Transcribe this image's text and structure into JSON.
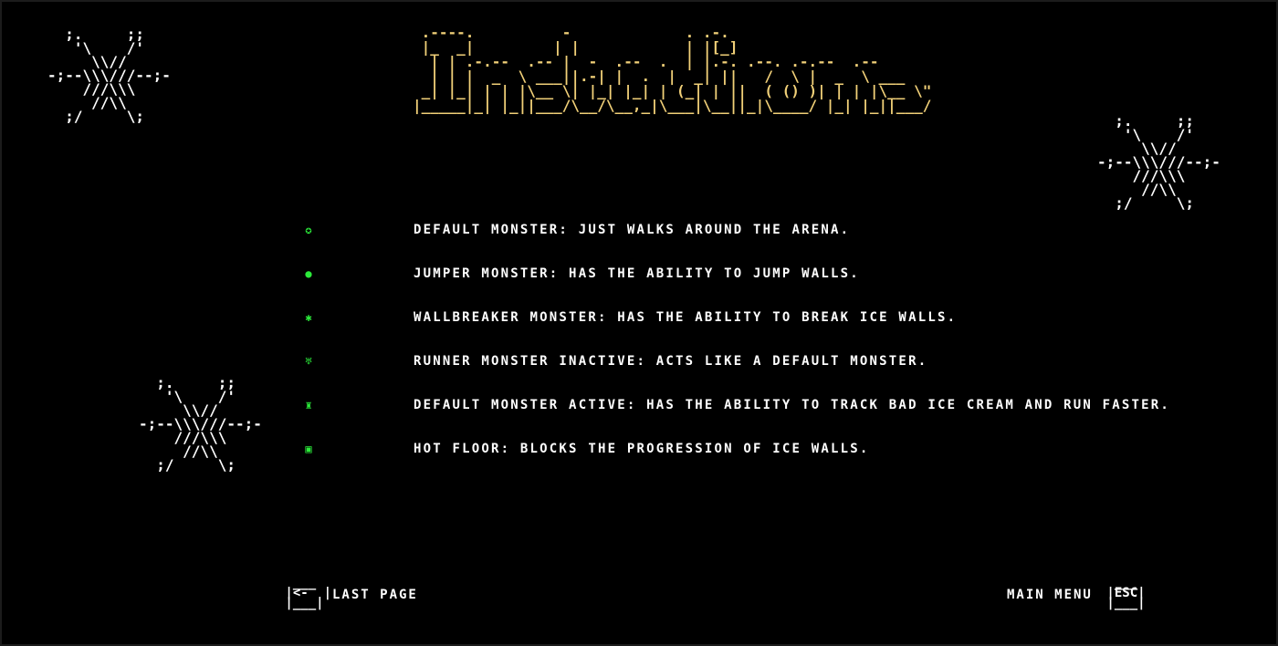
{
  "title": "Instructions",
  "title_color": "#f1d078",
  "legend": [
    {
      "icon": "green-star-icon",
      "glyph": "✪",
      "text": "Default monster: just walks around the arena."
    },
    {
      "icon": "green-blob-icon",
      "glyph": "●",
      "text": "Jumper monster: has the ability to jump walls."
    },
    {
      "icon": "green-bug-icon",
      "glyph": "✱",
      "text": "Wallbreaker monster: has the ability to break ice walls."
    },
    {
      "icon": "green-creature-icon",
      "glyph": "♅",
      "text": "Runner monster inactive: acts like a default monster."
    },
    {
      "icon": "green-runner-icon",
      "glyph": "♜",
      "text": "Default monster active: has the ability to track bad ice cream and run faster."
    },
    {
      "icon": "green-tile-icon",
      "glyph": "▣",
      "text": "Hot floor: blocks the progression of ice walls."
    }
  ],
  "icon_color": "#2bea3a",
  "navigation": {
    "back_key": "<-",
    "back_label": "Last page",
    "menu_key": "ESC",
    "menu_label": "Main menu"
  }
}
